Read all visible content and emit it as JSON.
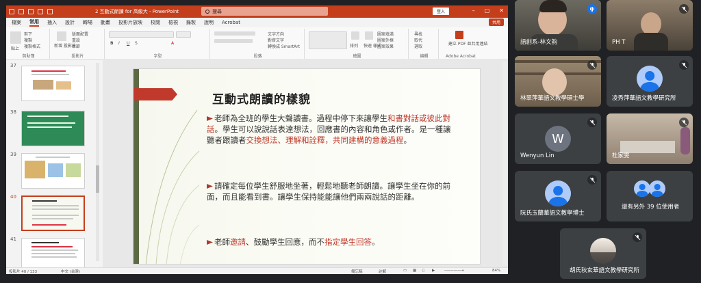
{
  "powerpoint": {
    "window_title": "2 互動式朗讀 for 高級大  -  PowerPoint",
    "search_placeholder": "搜尋",
    "login_label": "登入",
    "share_label": "共用",
    "window_controls": [
      "minimize-icon",
      "restore-icon",
      "close-icon"
    ],
    "menu": [
      "檔案",
      "常用",
      "插入",
      "設計",
      "轉場",
      "動畫",
      "投影片放映",
      "校閱",
      "檢視",
      "錄製",
      "說明",
      "Acrobat"
    ],
    "active_menu": "常用",
    "ribbon_groups": {
      "clipboard": "剪貼簿",
      "slides": "投影片",
      "font": "字型",
      "paragraph": "段落",
      "drawing": "繪圖",
      "editing": "編輯",
      "adobe": "Adobe Acrobat"
    },
    "ribbon_items": {
      "paste": "貼上",
      "cut": "剪下",
      "copy": "複製",
      "format_painter": "複製格式",
      "new_slide": "新增\n投影片",
      "layout": "版面配置",
      "reset": "重設",
      "sections": "章節",
      "text_direction": "文字方向",
      "align_text": "對齊文字",
      "smartart": "轉換成 SmartArt",
      "arrange": "排列",
      "quick_styles": "快速\n樣式",
      "shape_fill": "圖案填滿",
      "shape_outline": "圖案外框",
      "shape_effects": "圖案效果",
      "find": "尋找",
      "replace": "取代",
      "select": "選取",
      "create_pdf": "建立 PDF\n並共用連結"
    },
    "thumbnails": [
      {
        "num": "37",
        "caption": "如果你是孩子，你怎麼樣讀這本書？"
      },
      {
        "num": "38",
        "caption": "老師朗讀與互動式朗讀"
      },
      {
        "num": "39",
        "caption": "繪本與讀本"
      },
      {
        "num": "40",
        "caption": "互動式朗讀的樣貌",
        "selected": true
      },
      {
        "num": "41",
        "caption": "互動式朗讀的步驟"
      }
    ],
    "slide": {
      "title": "互動式朗讀的樣貌",
      "bullets": [
        [
          {
            "t": "老師為全班的學生大聲讀書。過程中停下來讓學生"
          },
          {
            "t": "和書對話或彼此對話",
            "hl": true
          },
          {
            "t": "。學生可以說說話表達想法，回應書的內容和角色或作者。是一種讓聽者跟讀者"
          },
          {
            "t": "交換想法、理解和詮釋，共同建構的意義過程",
            "hl": true
          },
          {
            "t": "。"
          }
        ],
        [
          {
            "t": "請確定每位學生舒服地坐著，輕鬆地聽老師朗讀。讓學生坐在你的前面，而且能看到書。讓學生保持能能讓他們兩兩說話的距離。"
          }
        ],
        [
          {
            "t": "老師"
          },
          {
            "t": "邀請",
            "hl": true
          },
          {
            "t": "、鼓勵學生回應，而不"
          },
          {
            "t": "指定學生回答",
            "hl": true
          },
          {
            "t": "。"
          }
        ]
      ]
    },
    "status": {
      "slide_count": "投影片 40 / 133",
      "language": "中文 (台灣)",
      "notes": "備忘稿",
      "comments": "註解",
      "zoom": "84%"
    }
  },
  "participants": [
    {
      "name": "語創系-林文韵",
      "speaking": true
    },
    {
      "name": "PH T",
      "muted": true
    },
    {
      "name": "林翠萍華語文教學碩士學",
      "muted": true
    },
    {
      "name": "凌秀萍華語文教學研究所",
      "muted": true
    },
    {
      "name": "Wenyun Lin",
      "initial": "W",
      "muted": true
    },
    {
      "name": "杜家雯",
      "muted": true
    },
    {
      "name": "阮氏玉蘭華語文教學博士",
      "muted": true
    },
    {
      "name": "還有另外 39 位使用者"
    },
    {
      "name": "胡氏秋玄華語文教學研究所",
      "muted": true
    }
  ],
  "colors": {
    "ppt_accent": "#c43e1c",
    "slide_highlight": "#c0392b",
    "meet_bg": "#202124",
    "tile_bg": "#3c4043",
    "avatar_blue": "#1a73e8"
  }
}
